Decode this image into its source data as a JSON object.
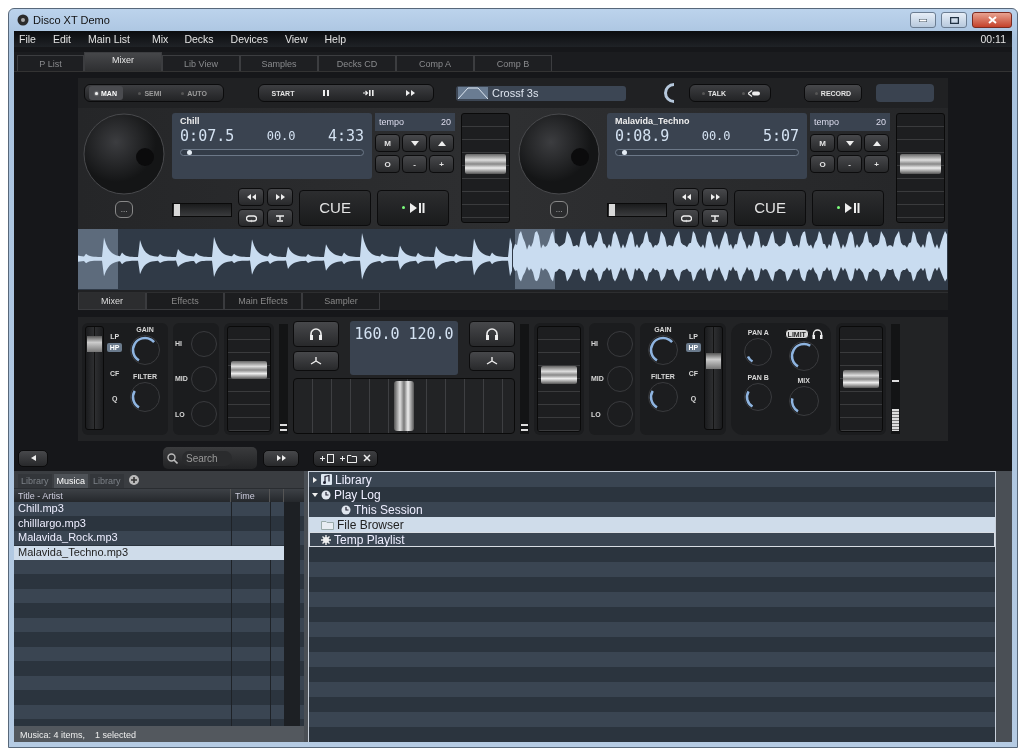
{
  "window": {
    "title": "Disco XT Demo",
    "clock": "00:11"
  },
  "menu": [
    "File",
    "Edit",
    "Main List",
    "Mix",
    "Decks",
    "Devices",
    "View",
    "Help"
  ],
  "tabs": [
    {
      "label": "P List",
      "selected": false
    },
    {
      "label": "Mixer",
      "selected": true
    },
    {
      "label": "Lib View",
      "selected": false
    },
    {
      "label": "Samples",
      "selected": false
    },
    {
      "label": "Decks CD",
      "selected": false
    },
    {
      "label": "Comp A",
      "selected": false
    },
    {
      "label": "Comp B",
      "selected": false
    }
  ],
  "modes": [
    {
      "label": "MAN",
      "selected": true
    },
    {
      "label": "SEMI",
      "selected": false
    },
    {
      "label": "AUTO",
      "selected": false
    }
  ],
  "autoplay": {
    "start": "START"
  },
  "crossfade": {
    "label": "Crossf 3s"
  },
  "talk": {
    "label": "TALK"
  },
  "record": {
    "label": "RECORD"
  },
  "decks": [
    {
      "title": "Chill",
      "elapsed": "0:07.5",
      "pitch": "00.0",
      "remaining": "4:33",
      "position": {
        "level": 0.03
      },
      "tempo_label": "tempo",
      "tempo_value": "20",
      "keys": [
        "M",
        "O",
        "-",
        "+"
      ],
      "pitch_slider": {
        "level": 0.02
      },
      "cue": "CUE",
      "more": "...",
      "fader": {
        "level": 0.55
      }
    },
    {
      "title": "Malavida_Techno",
      "elapsed": "0:08.9",
      "pitch": "00.0",
      "remaining": "5:07",
      "position": {
        "level": 0.03
      },
      "tempo_label": "tempo",
      "tempo_value": "20",
      "keys": [
        "M",
        "O",
        "-",
        "+"
      ],
      "pitch_slider": {
        "level": 0.02
      },
      "cue": "CUE",
      "more": "...",
      "fader": {
        "level": 0.55
      }
    }
  ],
  "mixer_tabs": [
    {
      "label": "Mixer",
      "selected": true
    },
    {
      "label": "Effects",
      "selected": false
    },
    {
      "label": "Main Effects",
      "selected": false
    },
    {
      "label": "Sampler",
      "selected": false
    }
  ],
  "mixer": {
    "channels": [
      {
        "gain": "GAIN",
        "filter": "FILTER",
        "filter_modes": [
          {
            "label": "LP",
            "selected": false
          },
          {
            "label": "HP",
            "selected": true
          }
        ],
        "cf": "CF",
        "q": "Q",
        "eq": [
          "HI",
          "MID",
          "LO"
        ],
        "pitch": {
          "level": 0.9
        },
        "fader": {
          "level": 0.6
        }
      },
      {
        "gain": "GAIN",
        "filter": "FILTER",
        "filter_modes": [
          {
            "label": "LP",
            "selected": false
          },
          {
            "label": "HP",
            "selected": true
          }
        ],
        "cf": "CF",
        "q": "Q",
        "eq": [
          "HI",
          "MID",
          "LO"
        ],
        "pitch": {
          "level": 0.7
        },
        "fader": {
          "level": 0.55
        }
      }
    ],
    "bpm": [
      "160.0",
      "120.0"
    ],
    "crossfader": {
      "level": 0.5
    },
    "master": {
      "pan_a": "PAN A",
      "pan_b": "PAN B",
      "mix": "MIX",
      "limit": "LIMIT",
      "fader": {
        "level": 0.5
      }
    }
  },
  "browser": {
    "search": {
      "placeholder": "Search"
    },
    "list_tabs": [
      {
        "label": "Library",
        "selected": false
      },
      {
        "label": "Musica",
        "selected": true
      },
      {
        "label": "Library",
        "selected": false
      }
    ],
    "columns": [
      "Title - Artist",
      "Time"
    ],
    "rows": [
      {
        "title": "Chill.mp3",
        "selected": false
      },
      {
        "title": "chilllargo.mp3",
        "selected": false
      },
      {
        "title": "Malavida_Rock.mp3",
        "selected": false
      },
      {
        "title": "Malavida_Techno.mp3",
        "selected": true
      }
    ],
    "status": {
      "count": "Musica: 4 items,",
      "selected": "1 selected"
    },
    "tree": [
      {
        "label": "Library",
        "kind": "library",
        "expanded": false,
        "selected": false,
        "focused": false
      },
      {
        "label": "Play Log",
        "kind": "log",
        "expanded": true,
        "selected": false,
        "focused": false,
        "children": [
          {
            "label": "This Session",
            "kind": "log",
            "selected": false,
            "focused": false
          }
        ]
      },
      {
        "label": "File Browser",
        "kind": "folder",
        "selected": true,
        "focused": false
      },
      {
        "label": "Temp Playlist",
        "kind": "playlist",
        "selected": false,
        "focused": true
      }
    ]
  }
}
